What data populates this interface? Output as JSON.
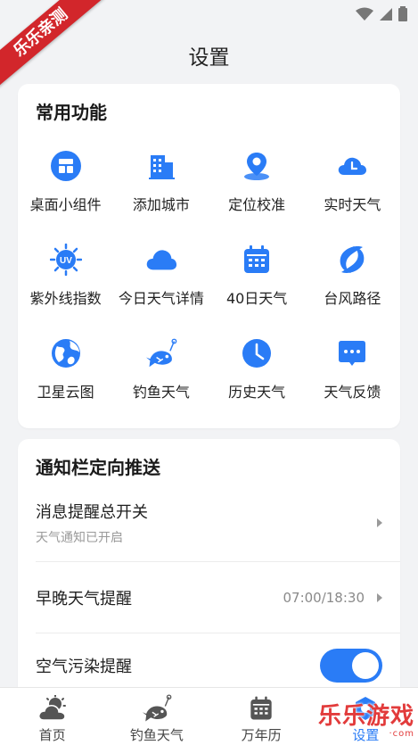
{
  "ribbon": {
    "text": "乐乐亲测"
  },
  "header": {
    "title": "设置"
  },
  "features": {
    "title": "常用功能",
    "items": [
      {
        "label": "桌面小组件",
        "icon": "widget-icon"
      },
      {
        "label": "添加城市",
        "icon": "building-icon"
      },
      {
        "label": "定位校准",
        "icon": "location-pin-icon"
      },
      {
        "label": "实时天气",
        "icon": "cloud-clock-icon"
      },
      {
        "label": "紫外线指数",
        "icon": "uv-sun-icon"
      },
      {
        "label": "今日天气详情",
        "icon": "cloud-icon"
      },
      {
        "label": "40日天气",
        "icon": "calendar-icon"
      },
      {
        "label": "台风路径",
        "icon": "typhoon-icon"
      },
      {
        "label": "卫星云图",
        "icon": "globe-icon"
      },
      {
        "label": "钓鱼天气",
        "icon": "fish-icon"
      },
      {
        "label": "历史天气",
        "icon": "clock-icon"
      },
      {
        "label": "天气反馈",
        "icon": "chat-bubble-icon"
      }
    ]
  },
  "notify": {
    "title": "通知栏定向推送",
    "master": {
      "title": "消息提醒总开关",
      "subtitle": "天气通知已开启"
    },
    "daily": {
      "title": "早晚天气提醒",
      "value": "07:00/18:30"
    },
    "air": {
      "title": "空气污染提醒",
      "enabled": true
    }
  },
  "tabs": [
    {
      "label": "首页",
      "icon": "weather-home-icon"
    },
    {
      "label": "钓鱼天气",
      "icon": "fish-tab-icon"
    },
    {
      "label": "万年历",
      "icon": "calendar-tab-icon"
    },
    {
      "label": "设置",
      "icon": "settings-tab-icon"
    }
  ],
  "watermark": {
    "main": "乐乐游戏",
    "sub": "·com"
  },
  "colors": {
    "accent": "#2a7cf6",
    "ribbon": "#d2262b"
  }
}
